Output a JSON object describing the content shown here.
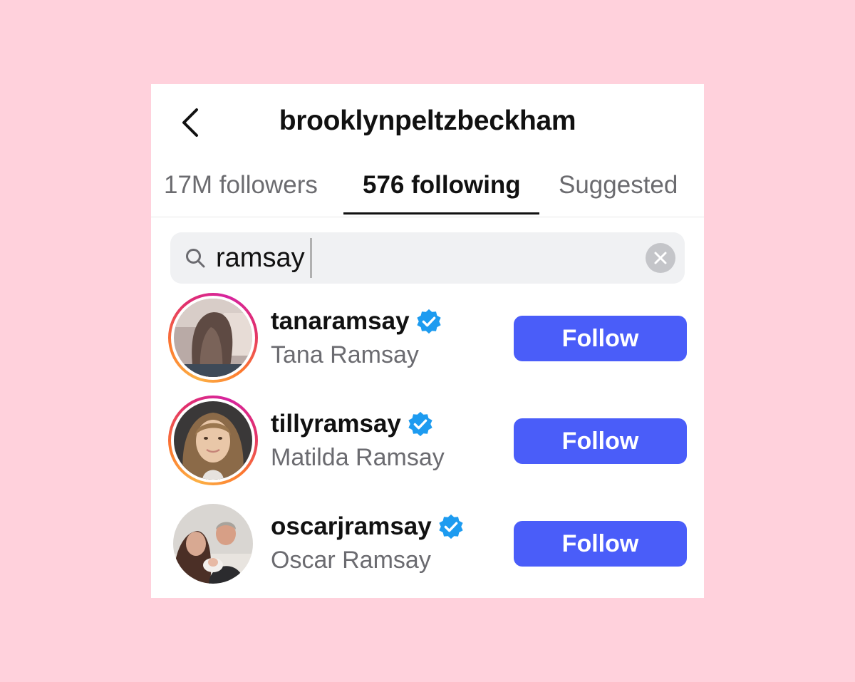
{
  "header": {
    "title": "brooklynpeltzbeckham",
    "back_icon": "chevron-left-icon"
  },
  "tabs": [
    {
      "label": "17M followers",
      "active": false
    },
    {
      "label": "576 following",
      "active": true
    },
    {
      "label": "Suggested",
      "active": false
    }
  ],
  "search": {
    "value": "ramsay",
    "icon": "search-icon",
    "clear_icon": "clear-icon"
  },
  "accounts": [
    {
      "username": "tanaramsay",
      "full_name": "Tana Ramsay",
      "verified": true,
      "story_ring": true,
      "button": "Follow"
    },
    {
      "username": "tillyramsay",
      "full_name": "Matilda Ramsay",
      "verified": true,
      "story_ring": true,
      "button": "Follow"
    },
    {
      "username": "oscarjramsay",
      "full_name": "Oscar Ramsay",
      "verified": true,
      "story_ring": false,
      "button": "Follow"
    }
  ],
  "colors": {
    "background": "#ffd1dc",
    "follow_button": "#4a5df9",
    "verified_badge": "#1d9bf0",
    "active_tab": "#111111",
    "inactive_tab": "#6b6b6f"
  }
}
